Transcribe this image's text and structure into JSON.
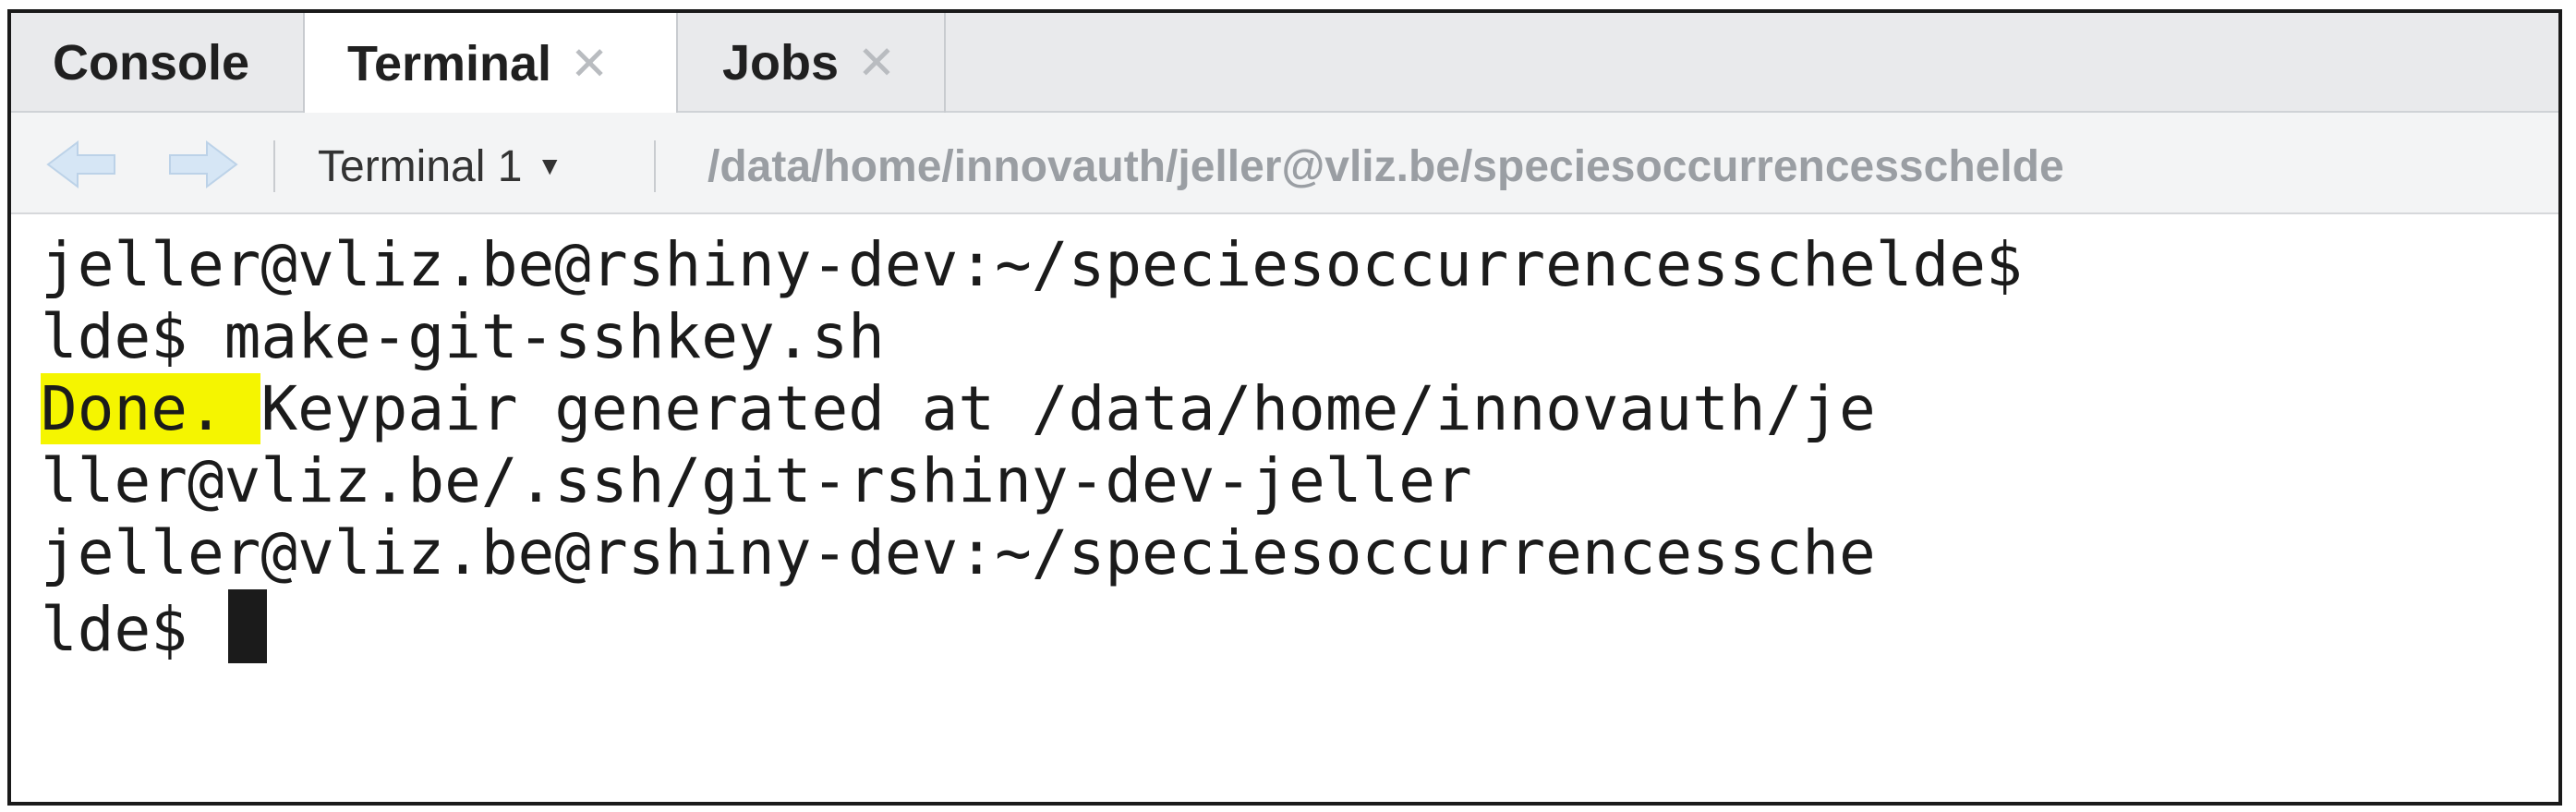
{
  "tabs": [
    {
      "label": "Console",
      "active": false,
      "closable": false
    },
    {
      "label": "Terminal",
      "active": true,
      "closable": true
    },
    {
      "label": "Jobs",
      "active": false,
      "closable": true
    }
  ],
  "toolbar": {
    "terminal_select": "Terminal 1",
    "path": "/data/home/innovauth/jeller@vliz.be/speciesoccurrencesschelde"
  },
  "terminal": {
    "lines": [
      "jeller@vliz.be@rshiny-dev:~/speciesoccurrencesschelde$",
      "lde$ make-git-sshkey.sh",
      "Keypair generated at /data/home/innovauth/je",
      "ller@vliz.be/.ssh/git-rshiny-dev-jeller",
      "jeller@vliz.be@rshiny-dev:~/speciesoccurrencessche",
      "lde$ "
    ],
    "highlighted_text": "Done.",
    "highlight_color": "#f5f500"
  },
  "colors": {
    "tab_bar": "#e9eaec",
    "toolbar": "#f3f4f5",
    "path_text": "#9a9ea3",
    "arrow": "#cfe1f2"
  },
  "icons": {
    "back": "arrow-left-icon",
    "forward": "arrow-right-icon",
    "close": "close-icon",
    "dropdown": "caret-down-icon"
  }
}
